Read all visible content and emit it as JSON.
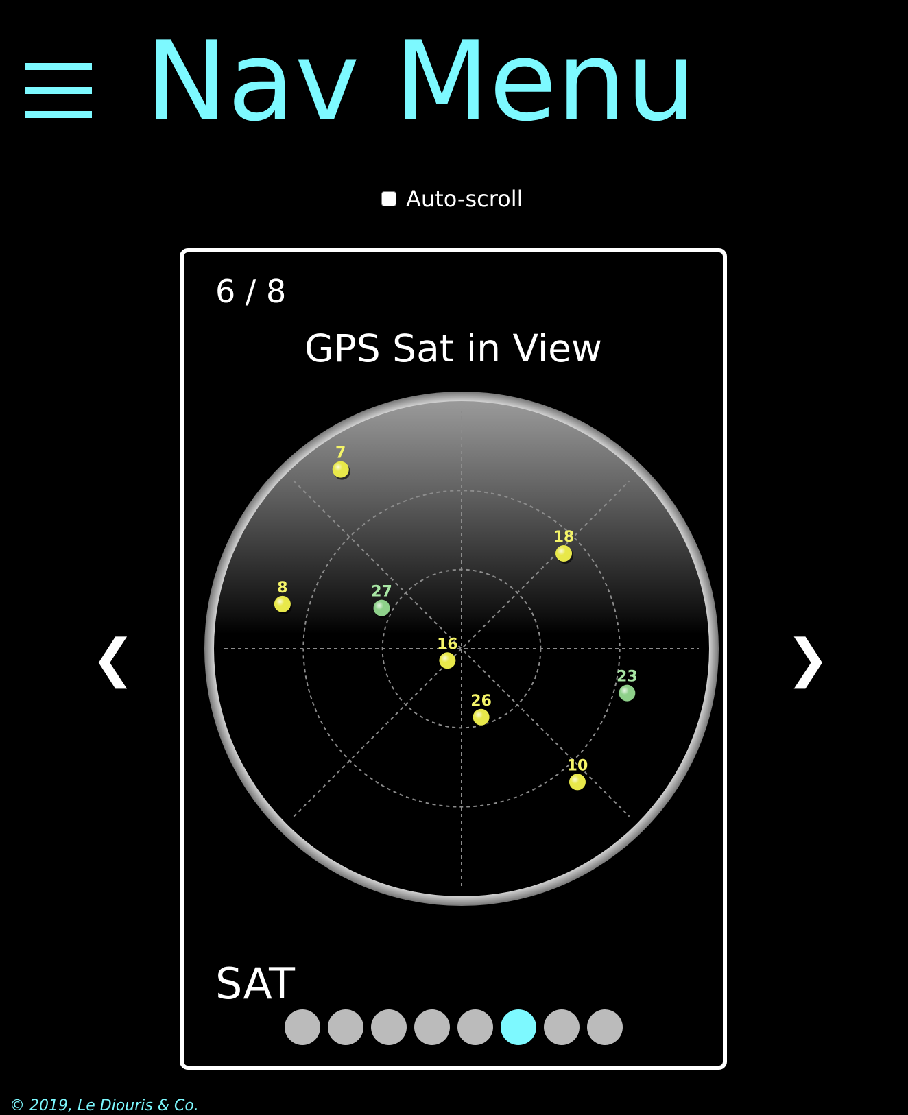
{
  "header": {
    "title": "Nav Menu",
    "menu_icon": "hamburger-menu-icon",
    "accent_color": "#7df9ff"
  },
  "autoscroll": {
    "label": "Auto-scroll",
    "checked": false
  },
  "slideshow": {
    "counter": "6 / 8",
    "title": "GPS Sat in View",
    "caption": "SAT",
    "current_index": 6,
    "total": 8,
    "prev_label": "❮",
    "next_label": "❯"
  },
  "radar": {
    "satellites": [
      {
        "id": "7",
        "azimuth": 326,
        "elevation": 8,
        "color": "#e8e84a",
        "label_color": "#f4f468"
      },
      {
        "id": "18",
        "azimuth": 47,
        "elevation": 37,
        "color": "#e8e84a",
        "label_color": "#f4f468"
      },
      {
        "id": "27",
        "azimuth": 297,
        "elevation": 56,
        "color": "#8ed08a",
        "label_color": "#a8e6a4"
      },
      {
        "id": "8",
        "azimuth": 284,
        "elevation": 20,
        "color": "#e8e84a",
        "label_color": "#f4f468"
      },
      {
        "id": "16",
        "azimuth": 230,
        "elevation": 83,
        "color": "#e8e84a",
        "label_color": "#f4f468"
      },
      {
        "id": "23",
        "azimuth": 105,
        "elevation": 25,
        "color": "#8ed08a",
        "label_color": "#a8e6a4"
      },
      {
        "id": "26",
        "azimuth": 164,
        "elevation": 63,
        "color": "#e8e84a",
        "label_color": "#f4f468"
      },
      {
        "id": "10",
        "azimuth": 139,
        "elevation": 23,
        "color": "#e8e84a",
        "label_color": "#f4f468"
      }
    ]
  },
  "footer": {
    "text": "© 2019, Le Diouris & Co."
  }
}
